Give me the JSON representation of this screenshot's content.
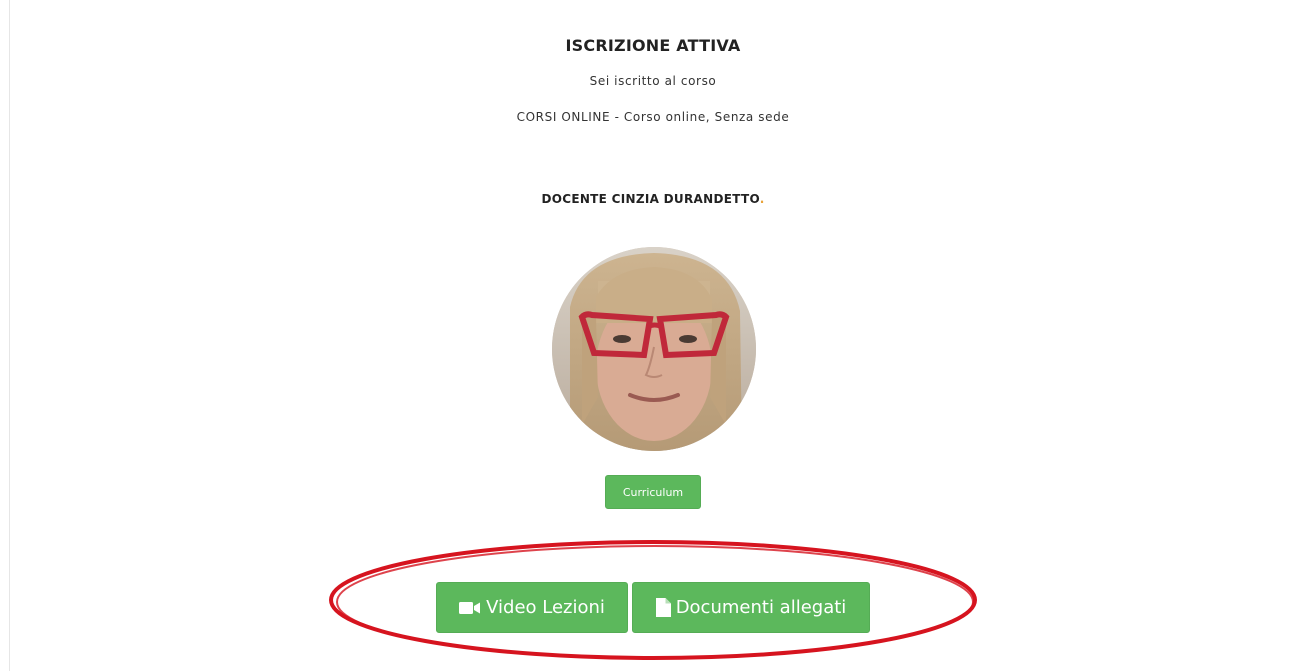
{
  "enrollment": {
    "status_title": "ISCRIZIONE ATTIVA",
    "enrolled_text": "Sei iscritto al corso",
    "course_text": "CORSI ONLINE - Corso online, Senza sede"
  },
  "teacher": {
    "name": "DOCENTE CINZIA DURANDETTO",
    "trailing_dot": ".",
    "curriculum_label": "Curriculum"
  },
  "actions": {
    "video_label": "Video Lezioni",
    "video_icon": "video-camera-icon",
    "documents_label": "Documenti allegati",
    "documents_icon": "document-icon"
  },
  "colors": {
    "button_green": "#5cb85c",
    "highlight_red": "#d6141f",
    "dot_orange": "#e9a43a"
  }
}
